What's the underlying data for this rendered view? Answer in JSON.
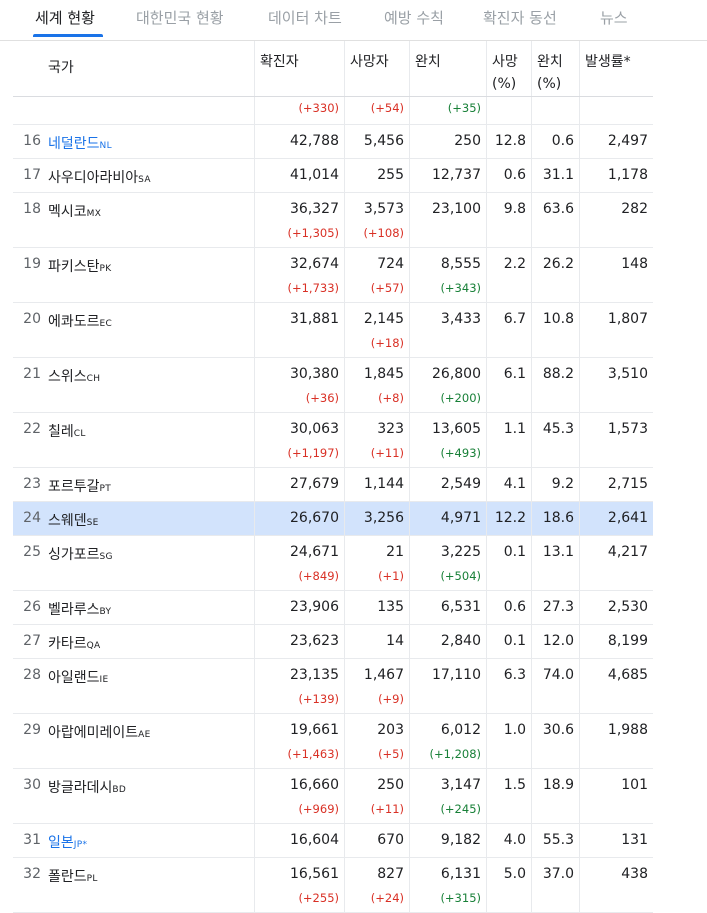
{
  "tabs": [
    "세계 현황",
    "대한민국 현황",
    "데이터 차트",
    "예방 수칙",
    "확진자 동선",
    "뉴스"
  ],
  "columns": [
    "국가",
    "확진자",
    "사망자",
    "완치",
    "사망\n(%)",
    "완치\n(%)",
    "발생률*"
  ],
  "colors": {
    "accent": "#1a73e8",
    "delta_up": "#d93025",
    "delta_recovered": "#188038",
    "selected_row": "#d2e3fc"
  },
  "partial_row": {
    "confirmed_delta": "(+330)",
    "deaths_delta": "(+54)",
    "recovered_delta": "(+35)"
  },
  "rows": [
    {
      "rank": "16",
      "name": "네덜란드",
      "code": "NL",
      "confirmed": "42,788",
      "deaths": "5,456",
      "recovered": "250",
      "death_rate": "12.8",
      "recovery_rate": "0.6",
      "incidence": "2,497",
      "link": true
    },
    {
      "rank": "17",
      "name": "사우디아라비아",
      "code": "SA",
      "confirmed": "41,014",
      "deaths": "255",
      "recovered": "12,737",
      "death_rate": "0.6",
      "recovery_rate": "31.1",
      "incidence": "1,178"
    },
    {
      "rank": "18",
      "name": "멕시코",
      "code": "MX",
      "confirmed": "36,327",
      "deaths": "3,573",
      "recovered": "23,100",
      "death_rate": "9.8",
      "recovery_rate": "63.6",
      "incidence": "282",
      "confirmed_delta": "(+1,305)",
      "deaths_delta": "(+108)"
    },
    {
      "rank": "19",
      "name": "파키스탄",
      "code": "PK",
      "confirmed": "32,674",
      "deaths": "724",
      "recovered": "8,555",
      "death_rate": "2.2",
      "recovery_rate": "26.2",
      "incidence": "148",
      "confirmed_delta": "(+1,733)",
      "deaths_delta": "(+57)",
      "recovered_delta": "(+343)"
    },
    {
      "rank": "20",
      "name": "에콰도르",
      "code": "EC",
      "confirmed": "31,881",
      "deaths": "2,145",
      "recovered": "3,433",
      "death_rate": "6.7",
      "recovery_rate": "10.8",
      "incidence": "1,807",
      "deaths_delta": "(+18)"
    },
    {
      "rank": "21",
      "name": "스위스",
      "code": "CH",
      "confirmed": "30,380",
      "deaths": "1,845",
      "recovered": "26,800",
      "death_rate": "6.1",
      "recovery_rate": "88.2",
      "incidence": "3,510",
      "confirmed_delta": "(+36)",
      "deaths_delta": "(+8)",
      "recovered_delta": "(+200)"
    },
    {
      "rank": "22",
      "name": "칠레",
      "code": "CL",
      "confirmed": "30,063",
      "deaths": "323",
      "recovered": "13,605",
      "death_rate": "1.1",
      "recovery_rate": "45.3",
      "incidence": "1,573",
      "confirmed_delta": "(+1,197)",
      "deaths_delta": "(+11)",
      "recovered_delta": "(+493)"
    },
    {
      "rank": "23",
      "name": "포르투갈",
      "code": "PT",
      "confirmed": "27,679",
      "deaths": "1,144",
      "recovered": "2,549",
      "death_rate": "4.1",
      "recovery_rate": "9.2",
      "incidence": "2,715"
    },
    {
      "rank": "24",
      "name": "스웨덴",
      "code": "SE",
      "confirmed": "26,670",
      "deaths": "3,256",
      "recovered": "4,971",
      "death_rate": "12.2",
      "recovery_rate": "18.6",
      "incidence": "2,641",
      "selected": true
    },
    {
      "rank": "25",
      "name": "싱가포르",
      "code": "SG",
      "confirmed": "24,671",
      "deaths": "21",
      "recovered": "3,225",
      "death_rate": "0.1",
      "recovery_rate": "13.1",
      "incidence": "4,217",
      "confirmed_delta": "(+849)",
      "deaths_delta": "(+1)",
      "recovered_delta": "(+504)"
    },
    {
      "rank": "26",
      "name": "벨라루스",
      "code": "BY",
      "confirmed": "23,906",
      "deaths": "135",
      "recovered": "6,531",
      "death_rate": "0.6",
      "recovery_rate": "27.3",
      "incidence": "2,530"
    },
    {
      "rank": "27",
      "name": "카타르",
      "code": "QA",
      "confirmed": "23,623",
      "deaths": "14",
      "recovered": "2,840",
      "death_rate": "0.1",
      "recovery_rate": "12.0",
      "incidence": "8,199"
    },
    {
      "rank": "28",
      "name": "아일랜드",
      "code": "IE",
      "confirmed": "23,135",
      "deaths": "1,467",
      "recovered": "17,110",
      "death_rate": "6.3",
      "recovery_rate": "74.0",
      "incidence": "4,685",
      "confirmed_delta": "(+139)",
      "deaths_delta": "(+9)"
    },
    {
      "rank": "29",
      "name": "아랍에미레이트",
      "code": "AE",
      "confirmed": "19,661",
      "deaths": "203",
      "recovered": "6,012",
      "death_rate": "1.0",
      "recovery_rate": "30.6",
      "incidence": "1,988",
      "confirmed_delta": "(+1,463)",
      "deaths_delta": "(+5)",
      "recovered_delta": "(+1,208)"
    },
    {
      "rank": "30",
      "name": "방글라데시",
      "code": "BD",
      "confirmed": "16,660",
      "deaths": "250",
      "recovered": "3,147",
      "death_rate": "1.5",
      "recovery_rate": "18.9",
      "incidence": "101",
      "confirmed_delta": "(+969)",
      "deaths_delta": "(+11)",
      "recovered_delta": "(+245)"
    },
    {
      "rank": "31",
      "name": "일본",
      "code": "JP*",
      "confirmed": "16,604",
      "deaths": "670",
      "recovered": "9,182",
      "death_rate": "4.0",
      "recovery_rate": "55.3",
      "incidence": "131",
      "link": true
    },
    {
      "rank": "32",
      "name": "폴란드",
      "code": "PL",
      "confirmed": "16,561",
      "deaths": "827",
      "recovered": "6,131",
      "death_rate": "5.0",
      "recovery_rate": "37.0",
      "incidence": "438",
      "confirmed_delta": "(+255)",
      "deaths_delta": "(+24)",
      "recovered_delta": "(+315)"
    }
  ]
}
